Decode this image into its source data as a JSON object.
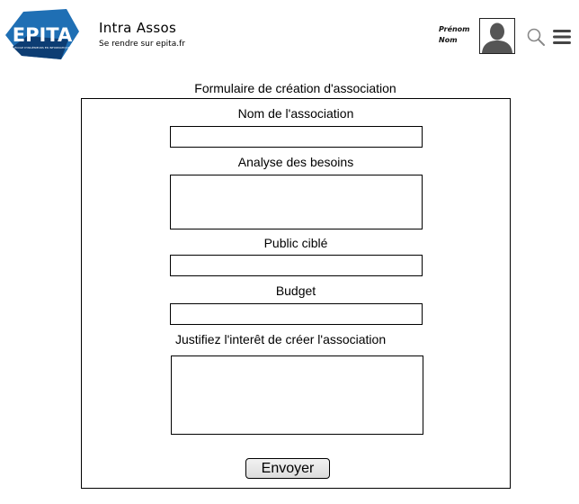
{
  "header": {
    "logo_text": "EPITA",
    "logo_subtitle": "ÉCOLE D'INGÉNIEURS EN INFORMATIQUE",
    "title": "Intra Assos",
    "link": "Se rendre sur epita.fr",
    "user_first_name": "Prénom",
    "user_last_name": "Nom",
    "icons": [
      "avatar",
      "search-icon",
      "menu-icon"
    ]
  },
  "form": {
    "title": "Formulaire de création d'association",
    "fields": [
      {
        "label": "Nom de l'association",
        "type": "text",
        "value": ""
      },
      {
        "label": "Analyse des besoins",
        "type": "textarea",
        "value": ""
      },
      {
        "label": "Public ciblé",
        "type": "text",
        "value": ""
      },
      {
        "label": "Budget",
        "type": "text",
        "value": ""
      },
      {
        "label": "Justifiez l'interêt de créer l'association",
        "type": "textarea",
        "value": ""
      }
    ],
    "submit_label": "Envoyer"
  },
  "colors": {
    "logo_blue": "#1f6fb4",
    "logo_dark": "#0d3d73",
    "border": "#000000"
  }
}
